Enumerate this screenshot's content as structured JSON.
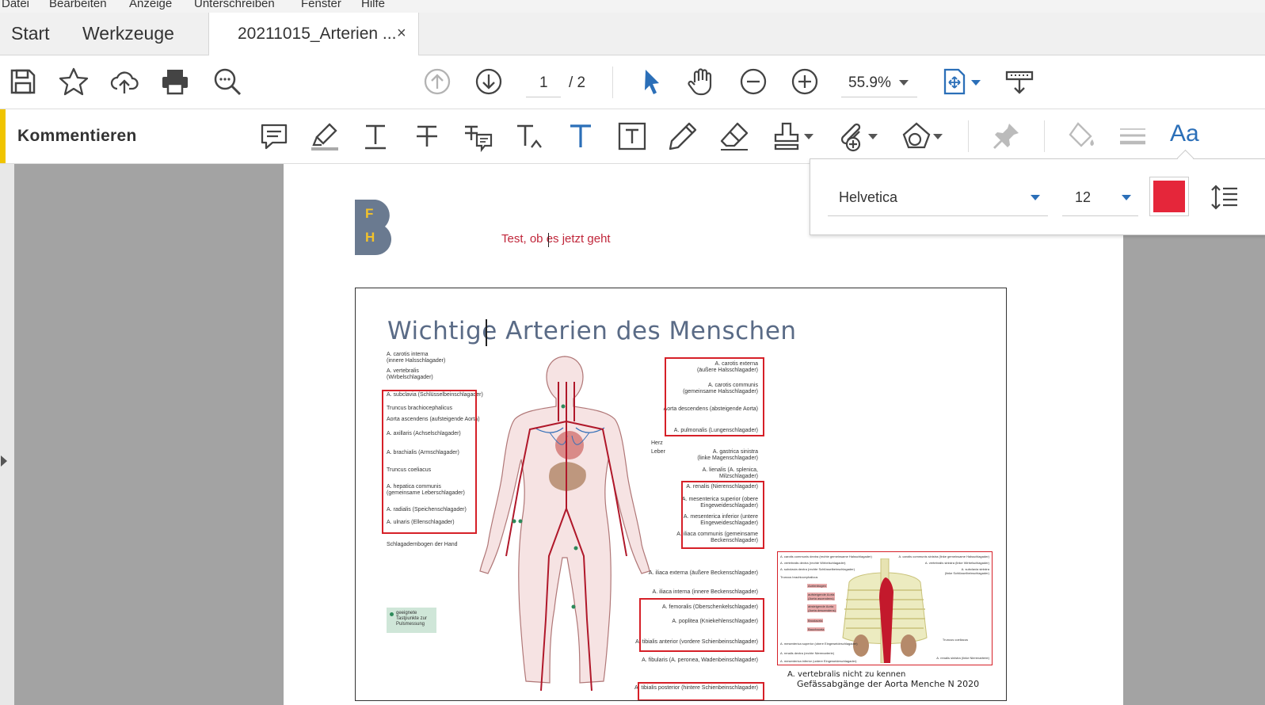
{
  "menu": [
    "Datei",
    "Bearbeiten",
    "Anzeige",
    "Unterschreiben",
    "Fenster",
    "Hilfe"
  ],
  "tabs": {
    "start": "Start",
    "tools": "Werkzeuge",
    "document": "20211015_Arterien ...",
    "close": "×"
  },
  "toolbar": {
    "icons": [
      "save-icon",
      "star-icon",
      "cloud-upload-icon",
      "print-icon",
      "zoom-search-icon",
      "page-up-icon",
      "page-down-icon",
      "select-arrow-icon",
      "hand-icon",
      "zoom-out-icon",
      "zoom-in-icon",
      "fit-page-icon",
      "scroll-mode-icon"
    ],
    "page_current": "1",
    "page_total": "/ 2",
    "zoom": "55.9%"
  },
  "comment_bar": {
    "title": "Kommentieren",
    "accent_color": "#f0c400",
    "icons": [
      "sticky-note-icon",
      "highlight-icon",
      "underline-text-icon",
      "strikethrough-icon",
      "replace-text-icon",
      "insert-text-icon",
      "add-text-icon",
      "text-box-icon",
      "pencil-icon",
      "eraser-icon",
      "stamp-icon",
      "attach-icon",
      "shapes-icon",
      "pin-icon",
      "fill-color-icon",
      "line-style-icon",
      "font-aa-icon"
    ],
    "font_aa": "Aa"
  },
  "font_panel": {
    "font": "Helvetica",
    "size": "12",
    "color": "#e5263a"
  },
  "document": {
    "logo_letters": [
      "F",
      "H"
    ],
    "note_text": "Test, ob es jetzt geht",
    "poster_title": "Wichtige Arterien des Menschen",
    "left_labels": [
      "A. carotis interna\n(innere Halsschlagader)",
      "A. vertebralis\n(Wirbelschlagader)",
      "A. subclavia (Schlüsselbeinschlagader)",
      "Truncus brachiocephalicus",
      "Aorta ascendens (aufsteigende Aorta)",
      "A. axillaris (Achselschlagader)",
      "A. brachialis (Armschlagader)",
      "Truncus coeliacus",
      "A. hepatica communis\n(gemeinsame Leberschlagader)",
      "A. radialis (Speichenschlagader)",
      "A. ulnaris (Ellenschlagader)",
      "Schlagadernbogen der Hand"
    ],
    "right_labels": [
      "A. carotis externa\n(äußere Halsschlagader)",
      "A. carotis communis\n(gemeinsame Halsschlagader)",
      "Aorta descendens (absteigende Aorta)",
      "A. pulmonalis (Lungenschlagader)",
      "Herz",
      "Leber",
      "A. gastrica sinistra\n(linke Magenschlagader)",
      "A. lienalis (A. splenica,\nMilzschlagader)",
      "A. renalis (Nierenschlagader)",
      "A. mesenterica superior (obere\nEingeweideschlagader)",
      "A. mesenterica inferior (untere\nEingeweideschlagader)",
      "A. iliaca communis (gemeinsame\nBeckenschlagader)",
      "A. iliaca externa (äußere Beckenschlagader)",
      "A. iliaca interna (innere Beckenschlagader)",
      "A. femoralis (Oberschenkelschlagader)",
      "A. poplitea (Kniekehlenschlagader)",
      "A. tibialis anterior (vordere Schienbeinschlagader)",
      "A. fibularis (A. peronea, Wadenbeinschlagader)",
      "A. tibialis posterior (hintere Schienbeinschlagader)"
    ],
    "legend": "geeignete\nTastpunkte zur\nPulsmessung",
    "legend_color": "#cfe6d8",
    "inset_note1": "A. vertebralis nicht zu kennen",
    "inset_note2": "Gefässabgänge der Aorta Menche N 2020",
    "inset_tags": [
      "Aortenbogen",
      "aufsteigende Aorta\n(Aorta ascendens)",
      "absteigende Aorta\n(Aorta descendens)",
      "Brustaorta",
      "Bauchaorta"
    ],
    "inset_left_labels": [
      "A. carotis communis dextra (rechte gemeinsame Halsschlagader)",
      "A. vertebralis dextra (rechte Wirbelschlagader)",
      "A. subclavia dextra (rechte Schlüsselbeinschlagader)",
      "Truncus brachiocephalicus",
      "A. mesenterica superior (obere Eingeweideschlagader)",
      "A. renalis dextra (rechte Nierenarterie)",
      "A. mesenterica inferior (untere Eingeweideschlagader)"
    ],
    "inset_right_labels": [
      "A. carotis communis sinistra (linke gemeinsame Halsschlagader)",
      "A. vertebralis sinistra (linke Wirbelschlagader)",
      "A. subclavia sinistra\n(linke Schlüsselbeinschlagader)",
      "Truncus coeliacus",
      "A. renalis sinistra (linke Nierenarterie)"
    ]
  }
}
